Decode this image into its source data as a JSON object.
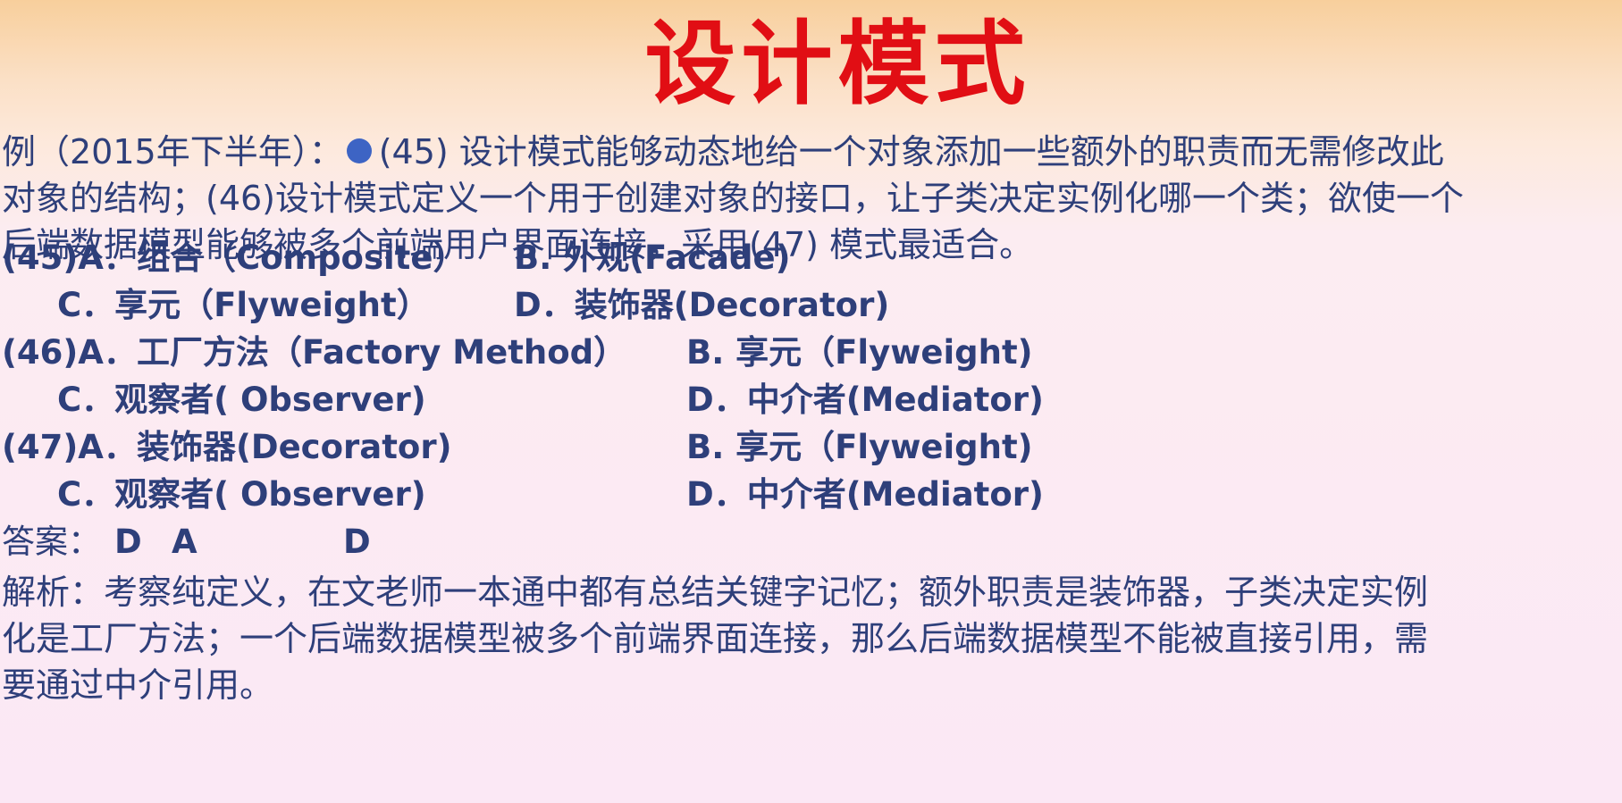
{
  "title": "设计模式",
  "question": {
    "line1_prefix": "例（2015年下半年）：",
    "line1_text": "(45) 设计模式能够动态地给一个对象添加一些额外的职责而无需修改此",
    "line2_text": "对象的结构；(46)设计模式定义一个用于创建对象的接口，让子类决定实例化哪一个类；欲使一个",
    "line3_text": "后端数据模型能够被多个前端用户界面连接，采用(47) 模式最适合。"
  },
  "options": {
    "q45": {
      "a": "(45)A．组合（Composite）",
      "b": "B. 外观(Facade)",
      "c": "C．享元（Flyweight）",
      "d": "D．装饰器(Decorator)"
    },
    "q46": {
      "a": "(46)A．工厂方法（Factory Method）",
      "b": "B. 享元（Flyweight)",
      "c": "C．观察者( Observer)",
      "d": "D．中介者(Mediator)"
    },
    "q47": {
      "a": "(47)A．装饰器(Decorator)",
      "b": "B. 享元（Flyweight)",
      "c": "C．观察者( Observer)",
      "d": "D．中介者(Mediator)"
    }
  },
  "answer": {
    "label": "答案：",
    "v1": "D",
    "v2": "A",
    "v3": "D"
  },
  "analysis": {
    "line1": "解析：考察纯定义，在文老师一本通中都有总结关键字记忆；额外职责是装饰器，子类决定实例",
    "line2": "化是工厂方法；一个后端数据模型被多个前端界面连接，那么后端数据模型不能被直接引用，需",
    "line3": "要通过中介引用。"
  },
  "colors": {
    "title": "#e10e14",
    "text": "#2e3f7a",
    "bullet": "#3d64c4"
  }
}
